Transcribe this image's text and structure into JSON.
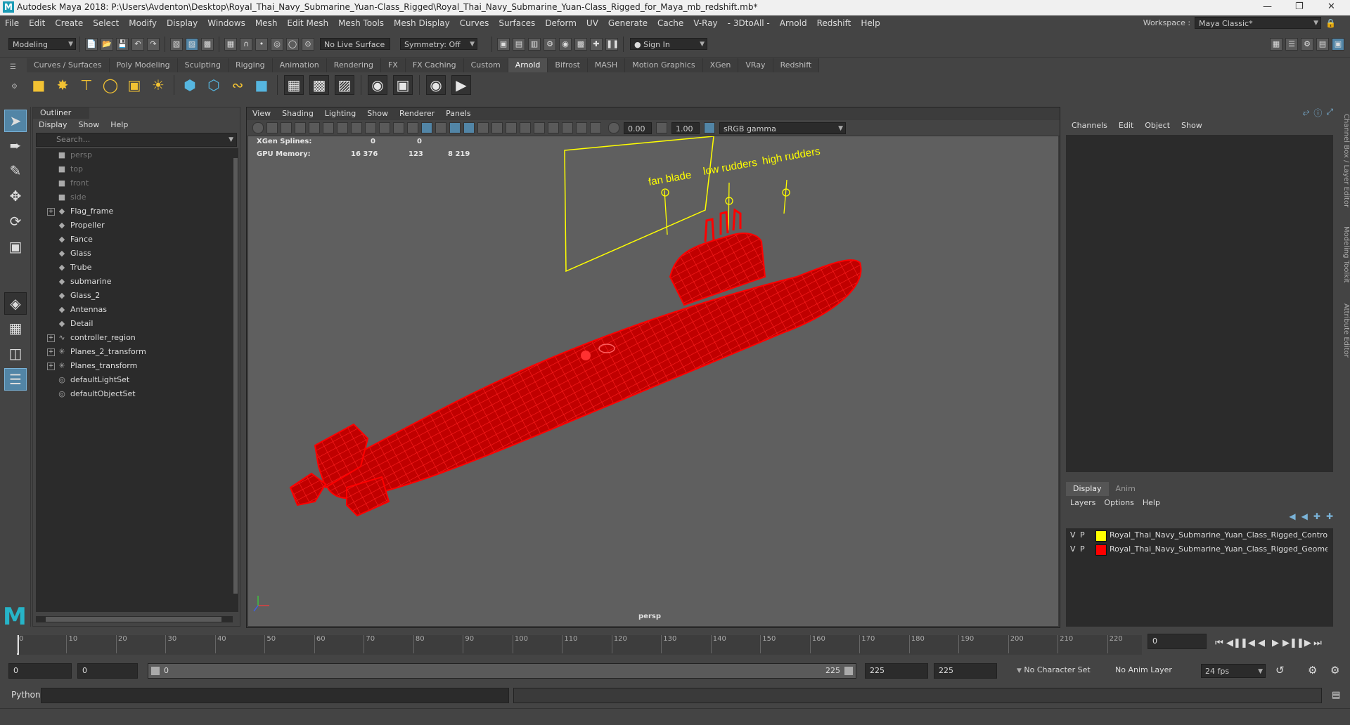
{
  "window": {
    "title": "Autodesk Maya 2018: P:\\Users\\Avdenton\\Desktop\\Royal_Thai_Navy_Submarine_Yuan-Class_Rigged\\Royal_Thai_Navy_Submarine_Yuan-Class_Rigged_for_Maya_mb_redshift.mb*",
    "logo": "M"
  },
  "menubar": {
    "items": [
      "File",
      "Edit",
      "Create",
      "Select",
      "Modify",
      "Display",
      "Windows",
      "Mesh",
      "Edit Mesh",
      "Mesh Tools",
      "Mesh Display",
      "Curves",
      "Surfaces",
      "Deform",
      "UV",
      "Generate",
      "Cache",
      "V-Ray",
      "- 3DtoAll -",
      "Arnold",
      "Redshift",
      "Help"
    ],
    "workspace_label": "Workspace :",
    "workspace_value": "Maya Classic*"
  },
  "statusline": {
    "mode": "Modeling",
    "live_surface": "No Live Surface",
    "symmetry": "Symmetry: Off",
    "sign_in": "Sign In"
  },
  "shelf": {
    "tabs": [
      "Curves / Surfaces",
      "Poly Modeling",
      "Sculpting",
      "Rigging",
      "Animation",
      "Rendering",
      "FX",
      "FX Caching",
      "Custom",
      "Arnold",
      "Bifrost",
      "MASH",
      "Motion Graphics",
      "XGen",
      "VRay",
      "Redshift"
    ],
    "active_tab": "Arnold"
  },
  "outliner": {
    "title": "Outliner",
    "menus": [
      "Display",
      "Show",
      "Help"
    ],
    "search_placeholder": "Search...",
    "items": [
      {
        "label": "persp",
        "icon": "camera-icon",
        "dim": true,
        "expand": false
      },
      {
        "label": "top",
        "icon": "camera-icon",
        "dim": true,
        "expand": false
      },
      {
        "label": "front",
        "icon": "camera-icon",
        "dim": true,
        "expand": false
      },
      {
        "label": "side",
        "icon": "camera-icon",
        "dim": true,
        "expand": false
      },
      {
        "label": "Flag_frame",
        "icon": "group-icon",
        "dim": false,
        "expand": true
      },
      {
        "label": "Propeller",
        "icon": "group-icon",
        "dim": false,
        "expand": false
      },
      {
        "label": "Fance",
        "icon": "group-icon",
        "dim": false,
        "expand": false
      },
      {
        "label": "Glass",
        "icon": "group-icon",
        "dim": false,
        "expand": false
      },
      {
        "label": "Trube",
        "icon": "group-icon",
        "dim": false,
        "expand": false
      },
      {
        "label": "submarine",
        "icon": "group-icon",
        "dim": false,
        "expand": false
      },
      {
        "label": "Glass_2",
        "icon": "group-icon",
        "dim": false,
        "expand": false
      },
      {
        "label": "Antennas",
        "icon": "group-icon",
        "dim": false,
        "expand": false
      },
      {
        "label": "Detail",
        "icon": "group-icon",
        "dim": false,
        "expand": false
      },
      {
        "label": "controller_region",
        "icon": "curve-icon",
        "dim": false,
        "expand": true
      },
      {
        "label": "Planes_2_transform",
        "icon": "star-icon",
        "dim": false,
        "expand": true
      },
      {
        "label": "Planes_transform",
        "icon": "star-icon",
        "dim": false,
        "expand": true
      },
      {
        "label": "defaultLightSet",
        "icon": "set-icon",
        "dim": false,
        "expand": false
      },
      {
        "label": "defaultObjectSet",
        "icon": "set-icon",
        "dim": false,
        "expand": false
      }
    ]
  },
  "viewport": {
    "menus": [
      "View",
      "Shading",
      "Lighting",
      "Show",
      "Renderer",
      "Panels"
    ],
    "exposure": "0.00",
    "gamma": "1.00",
    "colorspace": "sRGB gamma",
    "hud": {
      "xgen_label": "XGen Splines:",
      "xgen_vals": [
        "0",
        "0"
      ],
      "gpu_label": "GPU Memory:",
      "gpu_vals": [
        "16 376",
        "123",
        "8 219"
      ]
    },
    "camera": "persp",
    "annotations": [
      "fan blade",
      "low rudders",
      "high rudders"
    ]
  },
  "channelbox": {
    "menus": [
      "Channels",
      "Edit",
      "Object",
      "Show"
    ],
    "layer_tabs": [
      "Display",
      "Anim"
    ],
    "layer_menus": [
      "Layers",
      "Options",
      "Help"
    ],
    "layers": [
      {
        "v": "V",
        "p": "P",
        "color": "#ffff00",
        "name": "Royal_Thai_Navy_Submarine_Yuan_Class_Rigged_Control"
      },
      {
        "v": "V",
        "p": "P",
        "color": "#ff0000",
        "name": "Royal_Thai_Navy_Submarine_Yuan_Class_Rigged_Geomet"
      }
    ],
    "side_tabs": [
      "Channel Box / Layer Editor",
      "Modeling Toolkit",
      "Attribute Editor"
    ]
  },
  "timeslider": {
    "ticks": [
      "0",
      "10",
      "20",
      "30",
      "40",
      "50",
      "60",
      "70",
      "80",
      "90",
      "100",
      "110",
      "120",
      "130",
      "140",
      "150",
      "160",
      "170",
      "180",
      "190",
      "200",
      "210",
      "220"
    ],
    "current_frame": "0"
  },
  "rangeslider": {
    "start": "0",
    "playback_start": "0",
    "range_start": "0",
    "range_end": "225",
    "playback_end": "225",
    "end": "225",
    "character_set": "No Character Set",
    "anim_layer": "No Anim Layer",
    "fps": "24 fps"
  },
  "cmdline": {
    "language": "Python"
  },
  "colors": {
    "accent": "#5285a6",
    "wire": "#ff0000",
    "control": "#ffff00",
    "viewport_bg": "#5f5f5f"
  }
}
